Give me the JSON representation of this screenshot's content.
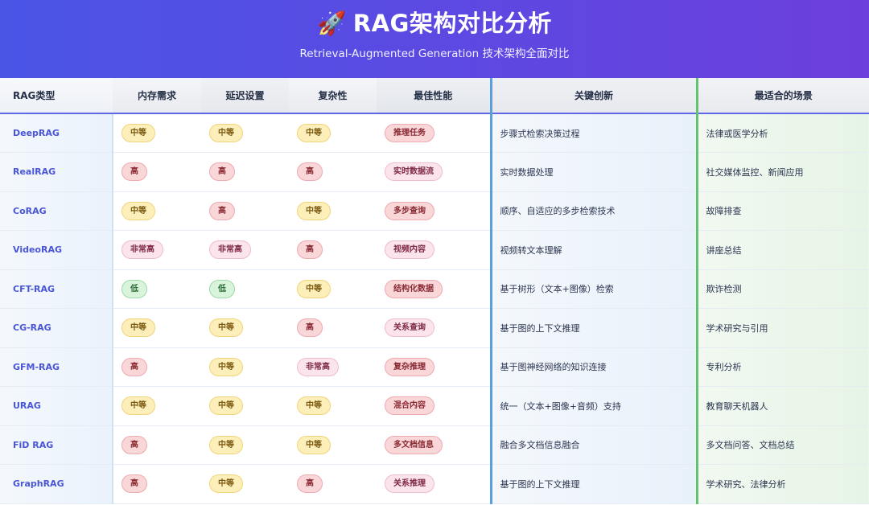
{
  "header": {
    "rocket": "🚀",
    "title": "RAG架构对比分析",
    "subtitle": "Retrieval-Augmented Generation 技术架构全面对比"
  },
  "columns": {
    "type": "RAG类型",
    "memory": "内存需求",
    "latency": "延迟设置",
    "complexity": "复杂性",
    "performance": "最佳性能",
    "innovation": "关键创新",
    "scenario": "最适合的场景"
  },
  "rows": [
    {
      "type": "DeepRAG",
      "memory": "中等",
      "latency": "中等",
      "complexity": "中等",
      "performance": "推理任务",
      "innovation": "步骤式检索决策过程",
      "scenario": "法律或医学分析"
    },
    {
      "type": "RealRAG",
      "memory": "高",
      "latency": "高",
      "complexity": "高",
      "performance": "实时数据流",
      "innovation": "实时数据处理",
      "scenario": "社交媒体监控、新闻应用"
    },
    {
      "type": "CoRAG",
      "memory": "中等",
      "latency": "高",
      "complexity": "中等",
      "performance": "多步查询",
      "innovation": "顺序、自适应的多步检索技术",
      "scenario": "故障排查"
    },
    {
      "type": "VideoRAG",
      "memory": "非常高",
      "latency": "非常高",
      "complexity": "高",
      "performance": "视频内容",
      "innovation": "视频转文本理解",
      "scenario": "讲座总结"
    },
    {
      "type": "CFT-RAG",
      "memory": "低",
      "latency": "低",
      "complexity": "中等",
      "performance": "结构化数据",
      "innovation": "基于树形（文本+图像）检索",
      "scenario": "欺诈检测"
    },
    {
      "type": "CG-RAG",
      "memory": "中等",
      "latency": "中等",
      "complexity": "高",
      "performance": "关系查询",
      "innovation": "基于图的上下文推理",
      "scenario": "学术研究与引用"
    },
    {
      "type": "GFM-RAG",
      "memory": "高",
      "latency": "中等",
      "complexity": "非常高",
      "performance": "复杂推理",
      "innovation": "基于图神经网络的知识连接",
      "scenario": "专利分析"
    },
    {
      "type": "URAG",
      "memory": "中等",
      "latency": "中等",
      "complexity": "中等",
      "performance": "混合内容",
      "innovation": "统一（文本+图像+音频）支持",
      "scenario": "教育聊天机器人"
    },
    {
      "type": "FiD RAG",
      "memory": "高",
      "latency": "中等",
      "complexity": "中等",
      "performance": "多文档信息",
      "innovation": "融合多文档信息融合",
      "scenario": "多文档问答、文档总结"
    },
    {
      "type": "GraphRAG",
      "memory": "高",
      "latency": "中等",
      "complexity": "高",
      "performance": "关系推理",
      "innovation": "基于图的上下文推理",
      "scenario": "学术研究、法律分析"
    }
  ],
  "colors": {
    "header_gradient_start": "#4a55e6",
    "header_gradient_end": "#6d3fdc",
    "type_text": "#4a55d8",
    "innovation_border": "#5aa0dc",
    "scenario_border": "#62c46e"
  },
  "badge_levels": {
    "低": "low",
    "中等": "medium",
    "高": "high",
    "非常高": "very-high"
  }
}
